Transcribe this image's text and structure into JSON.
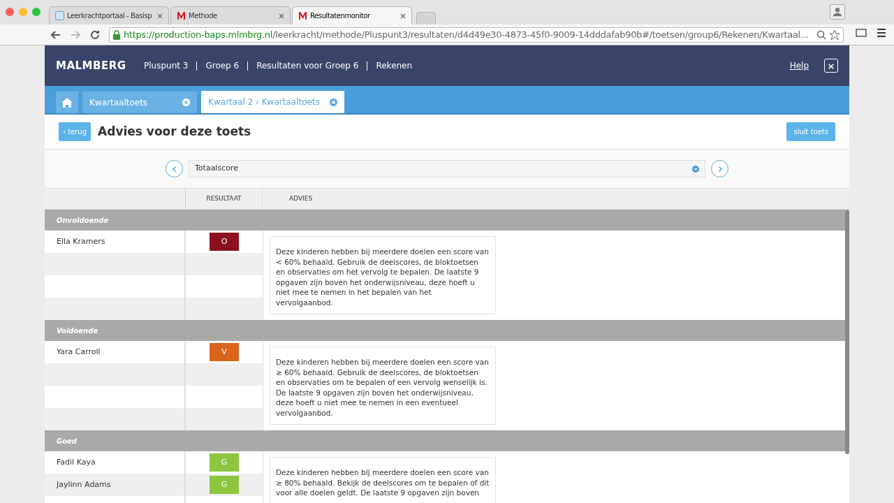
{
  "browser": {
    "tabs": [
      {
        "label": "Leerkrachtportaal - Basisp",
        "selected": false
      },
      {
        "label": "Methode",
        "selected": false
      },
      {
        "label": "Resultatenmonitor",
        "selected": true
      }
    ],
    "url_host": "https://production-baps.mlmbrg.nl",
    "url_path": "/leerkracht/methode/Pluspunt3/resultaten/d4d49e30-4873-45f0-9009-14dddafab90b#/toetsen/group6/Rekenen/Kwartaal..."
  },
  "header": {
    "logo": "MALMBERG",
    "breadcrumbs": [
      "Pluspunt 3",
      "Groep 6",
      "Resultaten voor Groep 6",
      "Rekenen"
    ],
    "help": "Help",
    "close": "×"
  },
  "tabs": [
    {
      "label": "Kwartaaltoets",
      "selected": false
    },
    {
      "label": "Kwartaal 2 › Kwartaaltoets",
      "selected": true
    }
  ],
  "toolbar": {
    "back": "‹ terug",
    "title": "Advies voor deze toets",
    "close_test": "sluit toets"
  },
  "selector": {
    "value": "Totaalscore"
  },
  "columns": [
    "RESULTAAT",
    "ADVIES"
  ],
  "groups": [
    {
      "name": "Onvoldoende",
      "advice": "Deze kinderen hebben bij meerdere doelen een score van < 60% behaald. Gebruik de deelscores, de bloktoetsen en observaties om het vervolg te bepalen. De laatste 9 opgaven zijn boven het onderwijsniveau, deze hoeft u niet mee te nemen in het bepalen van het vervolgaanbod.",
      "students": [
        {
          "name": "Ella Kramers",
          "result": "O",
          "color": "#8b1020"
        }
      ]
    },
    {
      "name": "Voldoende",
      "advice": "Deze kinderen hebben bij meerdere doelen een score van ≥ 60% behaald. Gebruik de deelscores, de bloktoetsen en observaties om te bepalen of een vervolg wenselijk is. De laatste 9 opgaven zijn boven het onderwijsniveau, deze hoeft u niet mee te nemen in een eventueel vervolgaanbod.",
      "students": [
        {
          "name": "Yara Carroll",
          "result": "V",
          "color": "#d9631a"
        }
      ]
    },
    {
      "name": "Goed",
      "advice": "Deze kinderen hebben bij meerdere doelen een score van ≥ 80% behaald. Bekijk de deelscores om te bepalen of dit voor alle doelen geldt. De laatste 9 opgaven zijn boven",
      "students": [
        {
          "name": "Fadil Kaya",
          "result": "G",
          "color": "#8cc63f"
        },
        {
          "name": "Jaylinn Adams",
          "result": "G",
          "color": "#8cc63f"
        }
      ]
    }
  ]
}
